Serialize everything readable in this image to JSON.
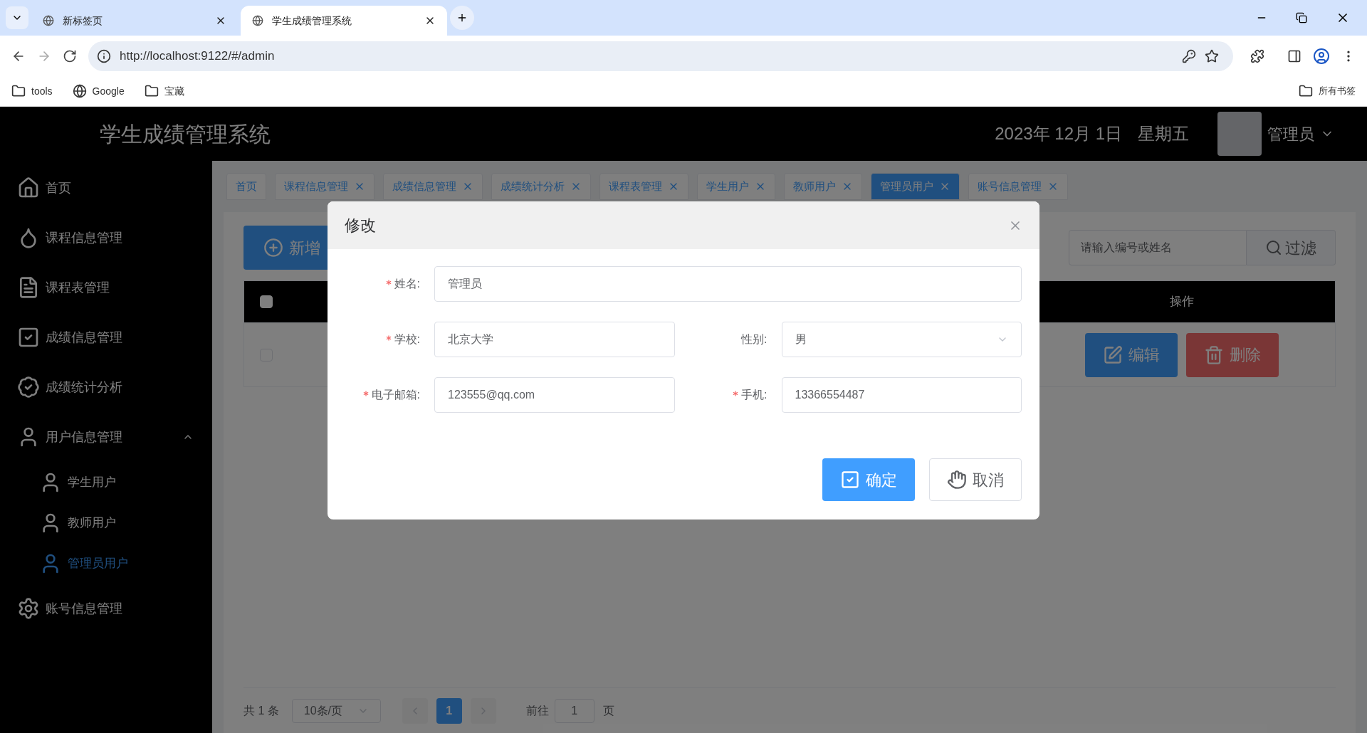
{
  "browser": {
    "tabs": [
      {
        "title": "新标签页",
        "selected": false
      },
      {
        "title": "学生成绩管理系统",
        "selected": true
      }
    ],
    "url": "http://localhost:9122/#/admin",
    "bookmarks": [
      {
        "kind": "folder",
        "label": "tools"
      },
      {
        "kind": "site",
        "label": "Google"
      },
      {
        "kind": "folder",
        "label": "宝藏"
      }
    ],
    "all_bookmarks": "所有书签"
  },
  "header": {
    "title": "学生成绩管理系统",
    "date": "2023年 12月 1日",
    "weekday": "星期五",
    "user": "管理员"
  },
  "sidebar": {
    "items": [
      {
        "label": "首页",
        "selected": false
      },
      {
        "label": "课程信息管理",
        "selected": false
      },
      {
        "label": "课程表管理",
        "selected": false
      },
      {
        "label": "成绩信息管理",
        "selected": false
      },
      {
        "label": "成绩统计分析",
        "selected": false
      },
      {
        "label": "用户信息管理",
        "selected": false,
        "expanded": true,
        "children": [
          {
            "label": "学生用户",
            "selected": false
          },
          {
            "label": "教师用户",
            "selected": false
          },
          {
            "label": "管理员用户",
            "selected": true
          }
        ]
      },
      {
        "label": "账号信息管理",
        "selected": false
      }
    ]
  },
  "page_tabs": [
    {
      "label": "首页",
      "closable": false,
      "selected": false
    },
    {
      "label": "课程信息管理",
      "closable": true,
      "selected": false
    },
    {
      "label": "成绩信息管理",
      "closable": true,
      "selected": false
    },
    {
      "label": "成绩统计分析",
      "closable": true,
      "selected": false
    },
    {
      "label": "课程表管理",
      "closable": true,
      "selected": false
    },
    {
      "label": "学生用户",
      "closable": true,
      "selected": false
    },
    {
      "label": "教师用户",
      "closable": true,
      "selected": false
    },
    {
      "label": "管理员用户",
      "closable": true,
      "selected": true
    },
    {
      "label": "账号信息管理",
      "closable": true,
      "selected": false
    }
  ],
  "toolbar": {
    "add_button": "新增",
    "search": {
      "placeholder": "请输入编号或姓名"
    },
    "filter_button": "过滤"
  },
  "table": {
    "select_all_checked": false,
    "action_column": "操作",
    "rows": [
      {
        "checked": false,
        "edit": "编辑",
        "delete": "删除"
      }
    ]
  },
  "pagination": {
    "total": "共 1 条",
    "page_size": "10条/页",
    "pages": [
      {
        "label": "1",
        "selected": true
      }
    ],
    "goto": "前往",
    "goto_value": "1",
    "page_suffix": "页"
  },
  "dialog": {
    "title": "修改",
    "rows": [
      [
        {
          "label": "姓名:",
          "required": true,
          "value": "管理员",
          "kind": "input"
        }
      ],
      [
        {
          "label": "学校:",
          "required": true,
          "value": "北京大学",
          "kind": "input"
        },
        {
          "label": "性别:",
          "required": false,
          "value": "男",
          "kind": "select"
        }
      ],
      [
        {
          "label": "电子邮箱:",
          "required": true,
          "value": "123555@qq.com",
          "kind": "input"
        },
        {
          "label": "手机:",
          "required": true,
          "value": "13366554487",
          "kind": "input"
        }
      ]
    ],
    "confirm": "确定",
    "cancel": "取消"
  }
}
